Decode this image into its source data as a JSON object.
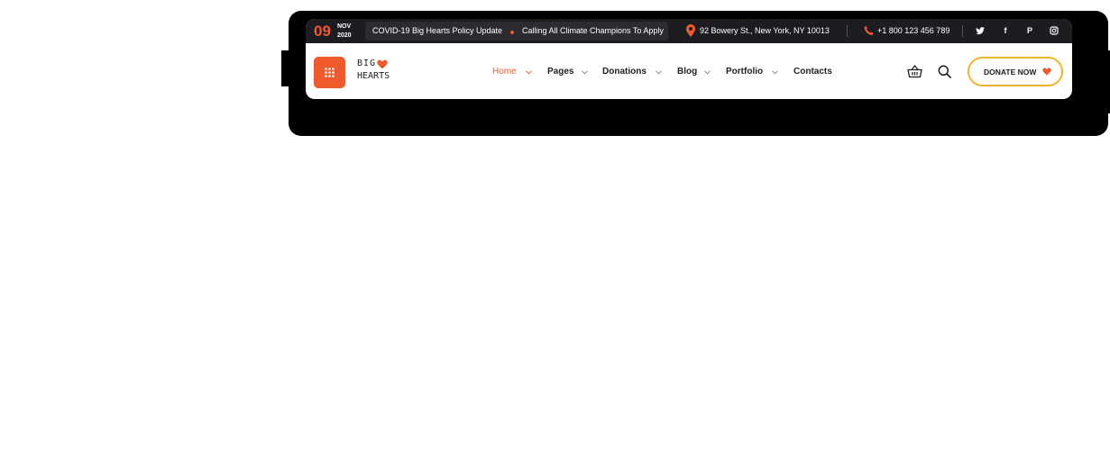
{
  "topbar": {
    "date": {
      "day": "09",
      "month": "NOV",
      "year": "2020"
    },
    "news": [
      "COVID-19 Big Hearts Policy Update",
      "Calling All Climate Champions To Apply"
    ],
    "address": "92 Bowery St., New York, NY 10013",
    "phone": "+1 800 123 456 789",
    "social_icons": [
      "twitter-icon",
      "facebook-icon",
      "pinterest-icon",
      "instagram-icon"
    ]
  },
  "header": {
    "menu_icon": "grid-icon",
    "logo": {
      "line1": "BIG",
      "line2": "HEARTS"
    },
    "nav": [
      {
        "label": "Home",
        "active": true,
        "has_dropdown": true
      },
      {
        "label": "Pages",
        "active": false,
        "has_dropdown": true
      },
      {
        "label": "Donations",
        "active": false,
        "has_dropdown": true
      },
      {
        "label": "Blog",
        "active": false,
        "has_dropdown": true
      },
      {
        "label": "Portfolio",
        "active": false,
        "has_dropdown": true
      },
      {
        "label": "Contacts",
        "active": false,
        "has_dropdown": false
      }
    ],
    "donate_label": "DONATE NOW"
  },
  "colors": {
    "accent": "#ee5a2c",
    "topbar_bg": "#1c1c21",
    "donate_border": "#f3b228"
  }
}
